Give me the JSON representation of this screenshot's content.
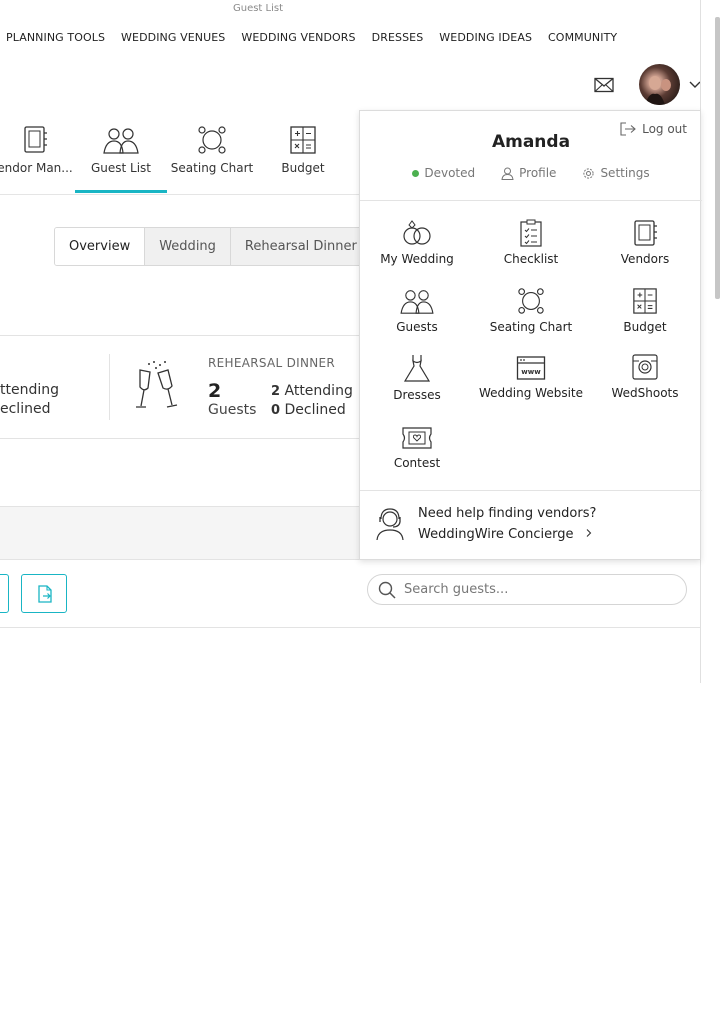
{
  "tab_title": "Guest List",
  "top_nav": [
    "PLANNING TOOLS",
    "WEDDING VENUES",
    "WEDDING VENDORS",
    "DRESSES",
    "WEDDING IDEAS",
    "COMMUNITY"
  ],
  "tools": {
    "vendor_manager": "endor Man...",
    "guest_list": "Guest List",
    "seating_chart": "Seating Chart",
    "budget": "Budget"
  },
  "segments": [
    "Overview",
    "Wedding",
    "Rehearsal Dinner"
  ],
  "wedding_stats": {
    "attending": "ttending",
    "declined": "eclined"
  },
  "rehearsal": {
    "title": "REHEARSAL DINNER",
    "guests_count": "2",
    "guests_label": "Guests",
    "attending_count": "2",
    "attending_label": "Attending",
    "declined_count": "0",
    "declined_label": "Declined"
  },
  "search": {
    "placeholder": "Search guests..."
  },
  "dropdown": {
    "logout": "Log out",
    "name": "Amanda",
    "status": "Devoted",
    "profile": "Profile",
    "settings": "Settings",
    "status_color": "#4cb050",
    "items": [
      {
        "label": "My Wedding",
        "icon": "rings-icon"
      },
      {
        "label": "Checklist",
        "icon": "checklist-icon"
      },
      {
        "label": "Vendors",
        "icon": "vendors-book-icon"
      },
      {
        "label": "Guests",
        "icon": "guests-icon"
      },
      {
        "label": "Seating Chart",
        "icon": "seating-table-icon"
      },
      {
        "label": "Budget",
        "icon": "calculator-icon"
      },
      {
        "label": "Dresses",
        "icon": "dress-icon"
      },
      {
        "label": "Wedding Website",
        "icon": "website-icon"
      },
      {
        "label": "WedShoots",
        "icon": "camera-icon"
      },
      {
        "label": "Contest",
        "icon": "contest-ticket-icon"
      }
    ],
    "help_title": "Need help finding vendors?",
    "help_link": "WeddingWire Concierge"
  },
  "accent_color": "#19b5c4"
}
